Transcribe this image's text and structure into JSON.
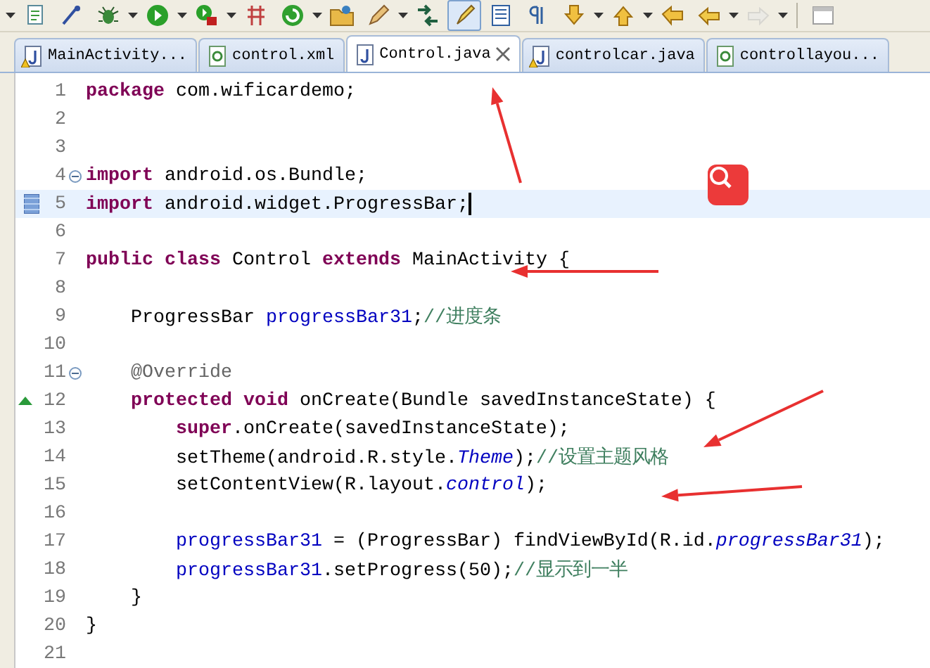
{
  "toolbar": [
    {
      "pressed": false,
      "dropdown": false,
      "disabled": false
    },
    {
      "pressed": false,
      "dropdown": false,
      "disabled": false
    },
    {
      "pressed": false,
      "dropdown": true,
      "disabled": false
    },
    {
      "pressed": false,
      "dropdown": true,
      "disabled": false
    },
    {
      "pressed": false,
      "dropdown": true,
      "disabled": false
    },
    {
      "pressed": false,
      "dropdown": false,
      "disabled": false
    },
    {
      "pressed": false,
      "dropdown": true,
      "disabled": false
    },
    {
      "pressed": false,
      "dropdown": false,
      "disabled": false
    },
    {
      "pressed": false,
      "dropdown": true,
      "disabled": false
    },
    {
      "pressed": false,
      "dropdown": false,
      "disabled": false
    },
    {
      "pressed": true,
      "dropdown": false,
      "disabled": false
    },
    {
      "pressed": false,
      "dropdown": false,
      "disabled": false
    },
    {
      "pressed": false,
      "dropdown": false,
      "disabled": false
    },
    {
      "pressed": false,
      "dropdown": true,
      "disabled": false
    },
    {
      "pressed": false,
      "dropdown": true,
      "disabled": false
    },
    {
      "pressed": false,
      "dropdown": false,
      "disabled": false
    },
    {
      "pressed": false,
      "dropdown": true,
      "disabled": false
    },
    {
      "pressed": false,
      "dropdown": true,
      "disabled": true
    },
    {
      "pressed": false,
      "dropdown": false,
      "disabled": false
    }
  ],
  "tabs": [
    {
      "label": "MainActivity...",
      "kind": "java",
      "warning": true,
      "selected": false
    },
    {
      "label": "control.xml",
      "kind": "xml",
      "warning": false,
      "selected": false
    },
    {
      "label": "Control.java",
      "kind": "java",
      "warning": false,
      "selected": true
    },
    {
      "label": "controlcar.java",
      "kind": "java",
      "warning": true,
      "selected": false
    },
    {
      "label": "controllayou...",
      "kind": "xml",
      "warning": false,
      "selected": false
    }
  ],
  "lines": [
    {
      "number": "1",
      "current": false,
      "tokens": [
        {
          "kind": "keyword",
          "text": "package"
        },
        {
          "kind": "plain",
          "text": " com.wificardemo;"
        }
      ]
    },
    {
      "number": "2",
      "current": false
    },
    {
      "number": "3",
      "current": false
    },
    {
      "number": "4",
      "current": false,
      "collapsible": true,
      "tokens": [
        {
          "kind": "keyword",
          "text": "import"
        },
        {
          "kind": "plain",
          "text": " android.os.Bundle;"
        }
      ]
    },
    {
      "number": "5",
      "current": true,
      "changed": true,
      "tokens": [
        {
          "kind": "keyword",
          "text": "import"
        },
        {
          "kind": "plain",
          "text": " android.widget.ProgressBar;"
        }
      ]
    },
    {
      "number": "6",
      "current": false
    },
    {
      "number": "7",
      "current": false,
      "tokens": [
        {
          "kind": "keyword",
          "text": "public class"
        },
        {
          "kind": "plain",
          "text": " Control "
        },
        {
          "kind": "keyword",
          "text": "extends"
        },
        {
          "kind": "plain",
          "text": " MainActivity {"
        }
      ]
    },
    {
      "number": "8",
      "current": false
    },
    {
      "number": "9",
      "current": false,
      "tokens": [
        {
          "kind": "plain",
          "text": "    ProgressBar "
        },
        {
          "kind": "field",
          "text": "progressBar31"
        },
        {
          "kind": "plain",
          "text": ";"
        },
        {
          "kind": "comment",
          "text": "//进度条"
        }
      ]
    },
    {
      "number": "10",
      "current": false
    },
    {
      "number": "11",
      "current": false,
      "collapsible": true,
      "tokens": [
        {
          "kind": "annotation",
          "text": "    @Override"
        }
      ]
    },
    {
      "number": "12",
      "current": false,
      "overrides": true,
      "tokens": [
        {
          "kind": "keyword",
          "text": "    protected void"
        },
        {
          "kind": "plain",
          "text": " onCreate(Bundle savedInstanceState) {"
        }
      ]
    },
    {
      "number": "13",
      "current": false,
      "tokens": [
        {
          "kind": "keyword",
          "text": "        super"
        },
        {
          "kind": "plain",
          "text": ".onCreate(savedInstanceState);"
        }
      ]
    },
    {
      "number": "14",
      "current": false,
      "tokens": [
        {
          "kind": "plain",
          "text": "        setTheme(android.R.style."
        },
        {
          "kind": "static",
          "text": "Theme"
        },
        {
          "kind": "plain",
          "text": ");"
        },
        {
          "kind": "comment",
          "text": "//设置主题风格"
        }
      ]
    },
    {
      "number": "15",
      "current": false,
      "tokens": [
        {
          "kind": "plain",
          "text": "        setContentView(R.layout."
        },
        {
          "kind": "static",
          "text": "control"
        },
        {
          "kind": "plain",
          "text": ");"
        }
      ]
    },
    {
      "number": "16",
      "current": false
    },
    {
      "number": "17",
      "current": false,
      "tokens": [
        {
          "kind": "field",
          "text": "        progressBar31"
        },
        {
          "kind": "plain",
          "text": " = (ProgressBar) findViewById(R.id."
        },
        {
          "kind": "static",
          "text": "progressBar31"
        },
        {
          "kind": "plain",
          "text": ");"
        }
      ]
    },
    {
      "number": "18",
      "current": false,
      "tokens": [
        {
          "kind": "field",
          "text": "        progressBar31"
        },
        {
          "kind": "plain",
          "text": ".setProgress(50);"
        },
        {
          "kind": "comment",
          "text": "//显示到一半"
        }
      ]
    },
    {
      "number": "19",
      "current": false,
      "tokens": [
        {
          "kind": "plain",
          "text": "    }"
        }
      ]
    },
    {
      "number": "20",
      "current": false,
      "tokens": [
        {
          "kind": "plain",
          "text": "}"
        }
      ]
    },
    {
      "number": "21",
      "current": false
    }
  ]
}
